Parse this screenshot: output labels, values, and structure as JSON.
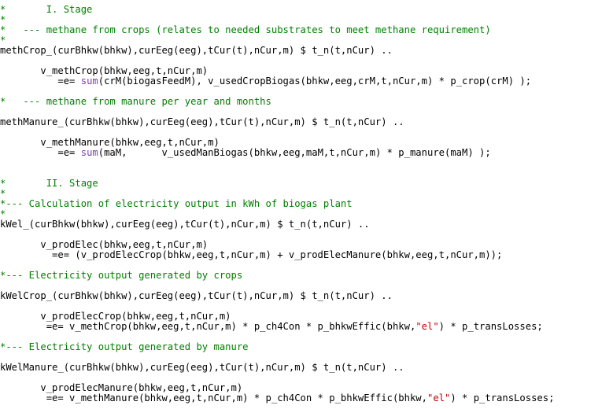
{
  "lines": [
    {
      "kind": "comment",
      "text": "*       I. Stage"
    },
    {
      "kind": "comment",
      "text": "*"
    },
    {
      "kind": "comment",
      "text": "*   --- methane from crops (relates to needed substrates to meet methane requirement)"
    },
    {
      "kind": "comment",
      "text": "*"
    },
    {
      "kind": "code",
      "text": "methCrop_(curBhkw(bhkw),curEeg(eeg),tCur(t),nCur,m) $ t_n(t,nCur) .."
    },
    {
      "kind": "blank",
      "text": ""
    },
    {
      "kind": "code",
      "text": "       v_methCrop(bhkw,eeg,t,nCur,m)"
    },
    {
      "kind": "code-sum",
      "pre": "          =e= ",
      "kw": "sum",
      "post": "(crM(biogasFeedM), v_usedCropBiogas(bhkw,eeg,crM,t,nCur,m) * p_crop(crM) );"
    },
    {
      "kind": "blank",
      "text": ""
    },
    {
      "kind": "comment",
      "text": "*   --- methane from manure per year and months"
    },
    {
      "kind": "blank",
      "text": ""
    },
    {
      "kind": "code",
      "text": "methManure_(curBhkw(bhkw),curEeg(eeg),tCur(t),nCur,m) $ t_n(t,nCur) .."
    },
    {
      "kind": "blank",
      "text": ""
    },
    {
      "kind": "code",
      "text": "       v_methManure(bhkw,eeg,t,nCur,m)"
    },
    {
      "kind": "code-sum",
      "pre": "          =e= ",
      "kw": "sum",
      "post": "(maM,      v_usedManBiogas(bhkw,eeg,maM,t,nCur,m) * p_manure(maM) );"
    },
    {
      "kind": "blank",
      "text": ""
    },
    {
      "kind": "blank",
      "text": ""
    },
    {
      "kind": "comment",
      "text": "*       II. Stage"
    },
    {
      "kind": "comment",
      "text": "*"
    },
    {
      "kind": "comment",
      "text": "*--- Calculation of electricity output in kWh of biogas plant"
    },
    {
      "kind": "comment",
      "text": "*"
    },
    {
      "kind": "code",
      "text": "kWel_(curBhkw(bhkw),curEeg(eeg),tCur(t),nCur,m) $ t_n(t,nCur) .."
    },
    {
      "kind": "blank",
      "text": ""
    },
    {
      "kind": "code",
      "text": "       v_prodElec(bhkw,eeg,t,nCur,m)"
    },
    {
      "kind": "code",
      "text": "         =e= (v_prodElecCrop(bhkw,eeg,t,nCur,m) + v_prodElecManure(bhkw,eeg,t,nCur,m));"
    },
    {
      "kind": "blank",
      "text": ""
    },
    {
      "kind": "comment",
      "text": "*--- Electricity output generated by crops"
    },
    {
      "kind": "blank",
      "text": ""
    },
    {
      "kind": "code",
      "text": "kWelCrop_(curBhkw(bhkw),curEeg(eeg),tCur(t),nCur,m) $ t_n(t,nCur) .."
    },
    {
      "kind": "blank",
      "text": ""
    },
    {
      "kind": "code",
      "text": "       v_prodElecCrop(bhkw,eeg,t,nCur,m)"
    },
    {
      "kind": "code-str",
      "pre": "        =e= v_methCrop(bhkw,eeg,t,nCur,m) * p_ch4Con * p_bhkwEffic(bhkw,",
      "str": "\"el\"",
      "post": ") * p_transLosses;"
    },
    {
      "kind": "blank",
      "text": ""
    },
    {
      "kind": "comment",
      "text": "*--- Electricity output generated by manure"
    },
    {
      "kind": "blank",
      "text": ""
    },
    {
      "kind": "code",
      "text": "kWelManure_(curBhkw(bhkw),curEeg(eeg),tCur(t),nCur,m) $ t_n(t,nCur) .."
    },
    {
      "kind": "blank",
      "text": ""
    },
    {
      "kind": "code",
      "text": "       v_prodElecManure(bhkw,eeg,t,nCur,m)"
    },
    {
      "kind": "code-str",
      "pre": "        =e= v_methManure(bhkw,eeg,t,nCur,m) * p_ch4Con * p_bhkwEffic(bhkw,",
      "str": "\"el\"",
      "post": ") * p_transLosses;"
    }
  ],
  "colors": {
    "comment": "#008000",
    "keyword": "#7f3ea6",
    "string": "#c00000",
    "text": "#000000",
    "background": "#ffffff"
  }
}
